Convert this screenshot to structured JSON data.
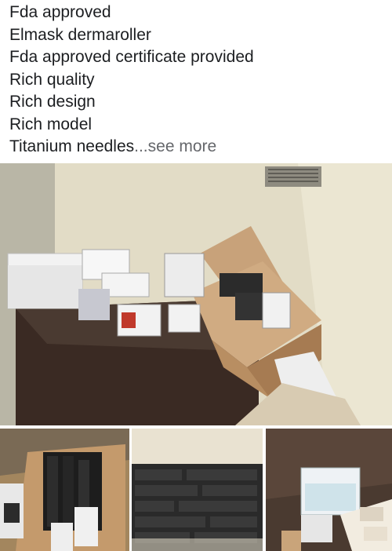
{
  "post": {
    "lines": [
      "Fda approved",
      "Elmask dermaroller",
      "Fda approved certificate provided",
      "Rich quality",
      "Rich design",
      "Rich model",
      "Titanium needles"
    ],
    "see_more": "...see more"
  },
  "photos": {
    "main": {
      "subject": "boxes-on-cabinet-photo"
    },
    "thumb_1": {
      "subject": "open-box-with-products-photo"
    },
    "thumb_2": {
      "subject": "stacked-product-boxes-photo"
    },
    "thumb_3": {
      "subject": "boxes-pile-photo"
    }
  }
}
